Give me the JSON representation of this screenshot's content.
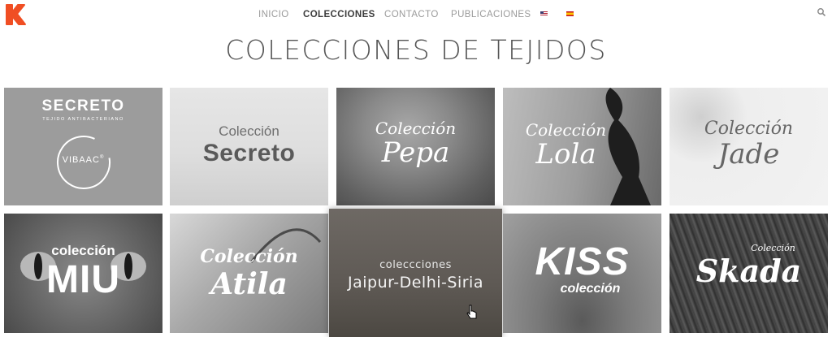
{
  "nav": {
    "items": [
      "INICIO",
      "COLECCIONES",
      "CONTACTO",
      "PUBLICACIONES"
    ],
    "active": "COLECCIONES",
    "languages": [
      "en-flag-icon",
      "es-flag-icon"
    ],
    "search_icon": "search-icon"
  },
  "brand": {
    "logo_icon": "k-logo-icon",
    "accent_color": "#f04e23"
  },
  "page": {
    "title": "COLECCIONES DE TEJIDOS"
  },
  "collections": [
    {
      "line1": "SECRETO",
      "line2": "TEJIDO ANTIBACTERIANO",
      "badge": "VIBAAC",
      "badge_mark": "®"
    },
    {
      "line1": "Colección",
      "line2": "Secreto"
    },
    {
      "line1": "Colección",
      "line2": "Pepa"
    },
    {
      "line1": "Colección",
      "line2": "Lola"
    },
    {
      "line1": "Colección",
      "line2": "Jade"
    },
    {
      "line1": "colección",
      "line2": "MIU"
    },
    {
      "line1": "Colección",
      "line2": "Atila"
    },
    {
      "line1": "coleccciones",
      "line2": "Jaipur-Delhi-Siria"
    },
    {
      "line1": "KISS",
      "line2": "colección"
    },
    {
      "line1": "Colección",
      "line2": "Skada"
    }
  ]
}
